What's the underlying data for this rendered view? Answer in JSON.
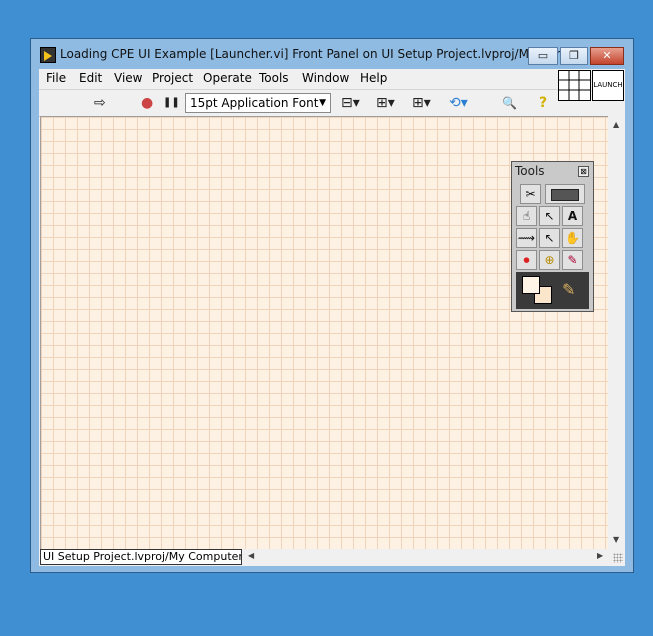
{
  "window": {
    "title": "Loading CPE UI Example [Launcher.vi] Front Panel on UI Setup Project.lvproj/My Com...",
    "controls": {
      "minimize": "▭",
      "maximize": "❐",
      "close": "✕"
    }
  },
  "menu": [
    "File",
    "Edit",
    "View",
    "Project",
    "Operate",
    "Tools",
    "Window",
    "Help"
  ],
  "toolbar": {
    "run_icon": "⇨",
    "abort_icon": "●",
    "pause_icon": "❚❚",
    "font": "15pt Application Font",
    "font_dropdown_icon": "▼",
    "align_icon": "⊟▾",
    "distribute_icon": "⊞▾",
    "resize_icon": "⊞▾",
    "reorder_icon": "⟲▾",
    "search_icon": "🔍",
    "help_icon": "?"
  },
  "icon_pane": {
    "text": "LAUNCH"
  },
  "status": {
    "path": "UI Setup Project.lvproj/My Computer"
  },
  "tools_palette": {
    "title": "Tools",
    "close": "⊠",
    "tools": [
      "✂",
      "▬",
      "☝",
      "↖",
      "A",
      "⟿",
      "↖",
      "✋",
      "⏺",
      "⊕",
      "✎"
    ]
  },
  "colors": {
    "desktop": "#3f8fd2",
    "panel_bg": "#fdf1e4",
    "grid": "#f0d3bb"
  }
}
